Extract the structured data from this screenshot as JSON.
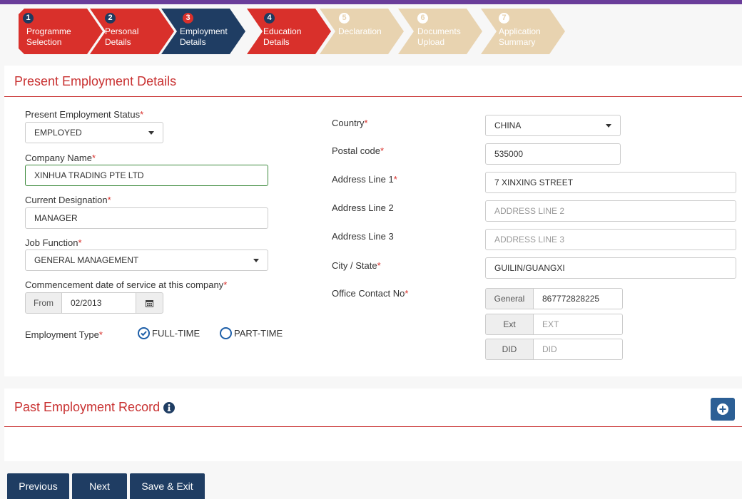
{
  "colors": {
    "accent": "#c93232",
    "step_done": "#d9302b",
    "step_active": "#1f3d63",
    "step_pending": "#e8d3b0",
    "button": "#1f3d63"
  },
  "steps": [
    {
      "num": "1",
      "label": "Programme Selection"
    },
    {
      "num": "2",
      "label": "Personal Details"
    },
    {
      "num": "3",
      "label": "Employment Details"
    },
    {
      "num": "4",
      "label": "Education Details"
    },
    {
      "num": "5",
      "label": "Declaration"
    },
    {
      "num": "6",
      "label": "Documents Upload"
    },
    {
      "num": "7",
      "label": "Application Summary"
    }
  ],
  "present": {
    "title": "Present Employment Details",
    "status_label": "Present Employment Status",
    "status_value": "EMPLOYED",
    "company_label": "Company Name",
    "company_value": "XINHUA TRADING PTE LTD",
    "designation_label": "Current Designation",
    "designation_value": "MANAGER",
    "job_function_label": "Job Function",
    "job_function_value": "GENERAL MANAGEMENT",
    "commencement_label": "Commencement date of service at this company",
    "from_label": "From",
    "from_value": "02/2013",
    "emp_type_label": "Employment Type",
    "emp_type_options": [
      {
        "label": "FULL-TIME",
        "selected": true
      },
      {
        "label": "PART-TIME",
        "selected": false
      }
    ],
    "country_label": "Country",
    "country_value": "CHINA",
    "postal_label": "Postal code",
    "postal_value": "535000",
    "addr1_label": "Address Line 1",
    "addr1_value": "7 XINXING STREET",
    "addr2_label": "Address Line 2",
    "addr2_placeholder": "ADDRESS LINE 2",
    "addr3_label": "Address Line 3",
    "addr3_placeholder": "ADDRESS LINE 3",
    "city_label": "City / State",
    "city_value": "GUILIN/GUANGXI",
    "office_label": "Office Contact No",
    "general_label": "General",
    "general_value": "867772828225",
    "ext_label": "Ext",
    "ext_placeholder": "EXT",
    "did_label": "DID",
    "did_placeholder": "DID",
    "required_mark": "*"
  },
  "past": {
    "title": "Past Employment Record"
  },
  "buttons": {
    "previous": "Previous",
    "next": "Next",
    "save_exit": "Save & Exit"
  }
}
